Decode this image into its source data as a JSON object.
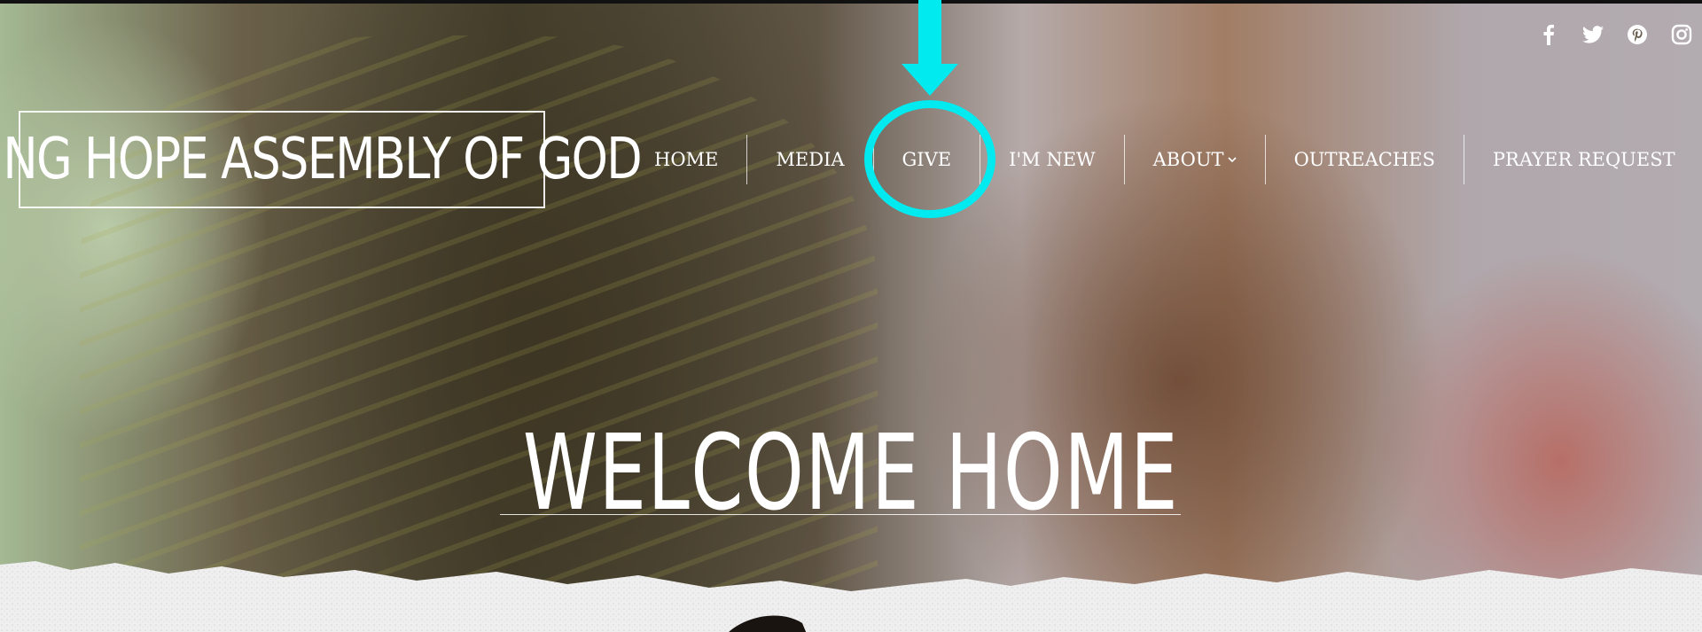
{
  "social": {
    "icons": [
      "facebook-icon",
      "twitter-icon",
      "pinterest-icon",
      "instagram-icon"
    ]
  },
  "logo": {
    "text": "LIVING HOPE ASSEMBLY OF GOD"
  },
  "nav": {
    "items": [
      {
        "label": "HOME"
      },
      {
        "label": "MEDIA"
      },
      {
        "label": "GIVE"
      },
      {
        "label": "I'M NEW"
      },
      {
        "label": "ABOUT"
      },
      {
        "label": "OUTREACHES"
      },
      {
        "label": "PRAYER REQUEST"
      }
    ]
  },
  "hero": {
    "title": "WELCOME HOME"
  },
  "annotation": {
    "color": "#00eaf0",
    "target": "GIVE"
  }
}
